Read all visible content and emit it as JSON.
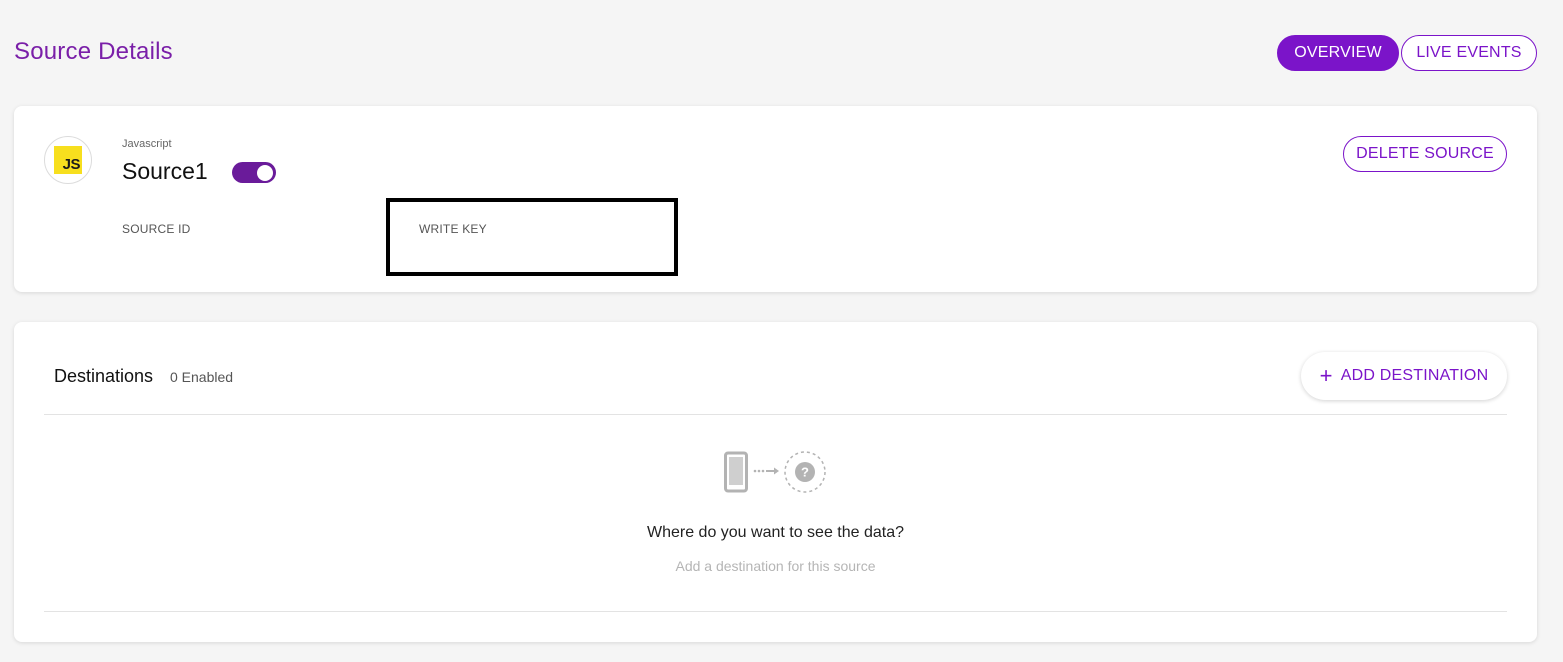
{
  "header": {
    "title": "Source Details",
    "tabs": [
      {
        "label": "OVERVIEW",
        "active": true
      },
      {
        "label": "LIVE EVENTS",
        "active": false
      }
    ]
  },
  "source": {
    "logo_text": "JS",
    "type": "Javascript",
    "name": "Source1",
    "enabled": true,
    "source_id_label": "SOURCE ID",
    "write_key_label": "WRITE KEY",
    "delete_label": "DELETE SOURCE"
  },
  "destinations": {
    "title": "Destinations",
    "count_text": "0 Enabled",
    "add_label": "ADD DESTINATION",
    "empty_title": "Where do you want to see the data?",
    "empty_subtitle": "Add a destination for this source"
  },
  "icons": {
    "logo": "javascript-logo-icon",
    "toggle": "toggle-switch",
    "add": "plus-icon",
    "device": "phone-icon",
    "arrow": "dotted-arrow-icon",
    "unknown": "question-icon"
  },
  "colors": {
    "accent": "#7b14c9",
    "title": "#7a1fa8",
    "toggle_on": "#6a1b9a",
    "js_yellow": "#f7df1e"
  }
}
